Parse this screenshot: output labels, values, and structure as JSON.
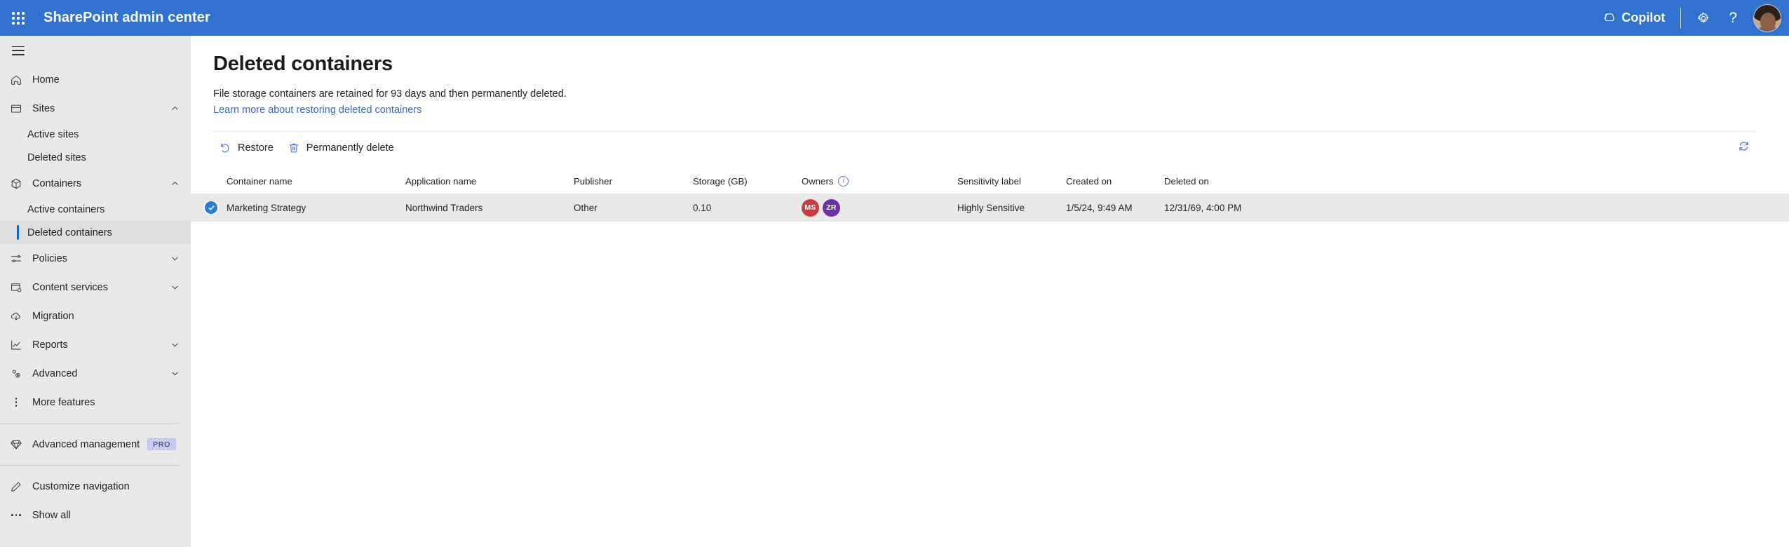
{
  "header": {
    "app_title": "SharePoint admin center",
    "waffle_icon": "app-launcher-icon",
    "copilot_label": "Copilot",
    "copilot_icon": "copilot-icon",
    "settings_icon": "gear-icon",
    "help_icon": "question-mark-icon",
    "avatar_icon": "user-avatar",
    "background_color": "#3172ce"
  },
  "sidebar": {
    "hamburger_icon": "hamburger-menu-icon",
    "items": [
      {
        "label": "Home",
        "icon": "home-icon",
        "type": "item",
        "expandable": false
      },
      {
        "label": "Sites",
        "icon": "sites-icon",
        "type": "item",
        "expandable": true,
        "expanded": true,
        "chevron": "chevron-up-icon"
      },
      {
        "label": "Active sites",
        "type": "sub",
        "selected": false
      },
      {
        "label": "Deleted sites",
        "type": "sub",
        "selected": false
      },
      {
        "label": "Containers",
        "icon": "containers-box-icon",
        "type": "item",
        "expandable": true,
        "expanded": true,
        "chevron": "chevron-up-icon"
      },
      {
        "label": "Active containers",
        "type": "sub",
        "selected": false
      },
      {
        "label": "Deleted containers",
        "type": "sub",
        "selected": true
      },
      {
        "label": "Policies",
        "icon": "policies-sliders-icon",
        "type": "item",
        "expandable": true,
        "expanded": false,
        "chevron": "chevron-down-icon"
      },
      {
        "label": "Content services",
        "icon": "content-services-icon",
        "type": "item",
        "expandable": true,
        "expanded": false,
        "chevron": "chevron-down-icon"
      },
      {
        "label": "Migration",
        "icon": "cloud-migration-icon",
        "type": "item",
        "expandable": false
      },
      {
        "label": "Reports",
        "icon": "reports-chart-icon",
        "type": "item",
        "expandable": true,
        "expanded": false,
        "chevron": "chevron-down-icon"
      },
      {
        "label": "Advanced",
        "icon": "advanced-gears-icon",
        "type": "item",
        "expandable": true,
        "expanded": false,
        "chevron": "chevron-down-icon"
      },
      {
        "label": "More features",
        "icon": "more-vertical-dots-icon",
        "type": "item",
        "expandable": false
      }
    ],
    "advanced_management": {
      "label": "Advanced management",
      "icon": "diamond-icon",
      "badge": "PRO",
      "badge_color": "#c7cdf2"
    },
    "footer_items": [
      {
        "label": "Customize navigation",
        "icon": "pencil-edit-icon"
      },
      {
        "label": "Show all",
        "icon": "more-horizontal-dots-icon"
      }
    ],
    "selected_accent_color": "#1266c0"
  },
  "page": {
    "title": "Deleted containers",
    "description": "File storage containers are retained for 93 days and then permanently deleted.",
    "link_text": "Learn more about restoring deleted containers",
    "link_color": "#3b68c4"
  },
  "commandbar": {
    "restore": {
      "label": "Restore",
      "icon": "restore-arrow-icon"
    },
    "permanently_delete": {
      "label": "Permanently delete",
      "icon": "trash-can-icon"
    },
    "refresh": {
      "label": "Refresh",
      "icon": "refresh-icon"
    },
    "icon_color": "#4a6fd4"
  },
  "table": {
    "columns": [
      {
        "key": "name",
        "label": "Container name"
      },
      {
        "key": "app",
        "label": "Application name"
      },
      {
        "key": "publisher",
        "label": "Publisher"
      },
      {
        "key": "storage",
        "label": "Storage (GB)"
      },
      {
        "key": "owners",
        "label": "Owners",
        "info_icon": "info-circle-icon"
      },
      {
        "key": "sensitivity",
        "label": "Sensitivity label"
      },
      {
        "key": "created",
        "label": "Created on"
      },
      {
        "key": "deleted",
        "label": "Deleted on"
      }
    ],
    "rows": [
      {
        "selected": true,
        "check_icon": "checkmark-circle-icon",
        "name": "Marketing Strategy",
        "app": "Northwind Traders",
        "publisher": "Other",
        "storage": "0.10",
        "owners": [
          {
            "initials": "MS",
            "color": "#cc3b44"
          },
          {
            "initials": "ZR",
            "color": "#6b2fa8"
          }
        ],
        "sensitivity": "Highly Sensitive",
        "created": "1/5/24, 9:49 AM",
        "deleted": "12/31/69, 4:00 PM"
      }
    ],
    "row_selected_background": "#e9e9e9"
  }
}
